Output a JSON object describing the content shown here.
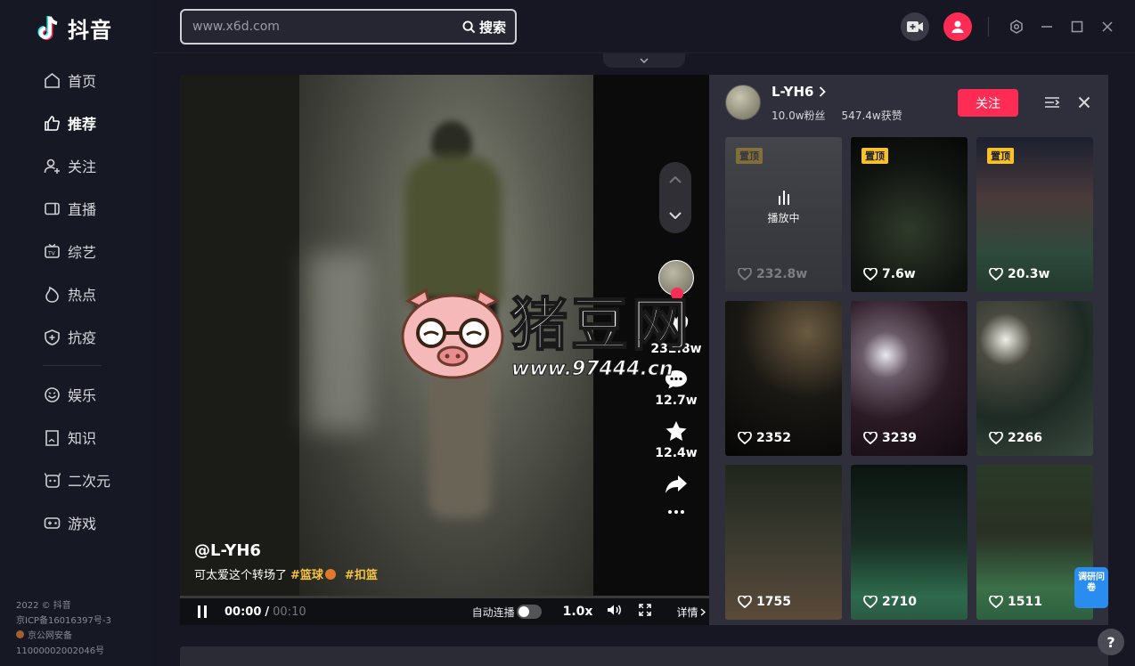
{
  "app": {
    "name": "抖音"
  },
  "search": {
    "placeholder": "www.x6d.com",
    "button_label": "搜索"
  },
  "sidebar": {
    "items": [
      {
        "label": "首页",
        "icon": "home-icon"
      },
      {
        "label": "推荐",
        "icon": "thumbs-up-icon",
        "active": true
      },
      {
        "label": "关注",
        "icon": "user-plus-icon"
      },
      {
        "label": "直播",
        "icon": "live-icon"
      },
      {
        "label": "综艺",
        "icon": "tv-icon"
      },
      {
        "label": "热点",
        "icon": "flame-icon"
      },
      {
        "label": "抗疫",
        "icon": "shield-plus-icon"
      }
    ],
    "items2": [
      {
        "label": "娱乐",
        "icon": "smile-icon"
      },
      {
        "label": "知识",
        "icon": "book-icon"
      },
      {
        "label": "二次元",
        "icon": "anime-icon"
      },
      {
        "label": "游戏",
        "icon": "gamepad-icon"
      }
    ],
    "footer": {
      "copyright": "2022 © 抖音",
      "icp": "京ICP备16016397号-3",
      "security": "京公网安备",
      "security_no": "11000002002046号"
    }
  },
  "player": {
    "author_handle": "@L-YH6",
    "caption": "可太爱这个转场了",
    "tags": [
      "#篮球",
      "#扣篮"
    ],
    "likes": "232.8w",
    "comments": "12.7w",
    "favorites": "12.4w",
    "time_current": "00:00",
    "time_separator": "/",
    "time_total": "00:10",
    "autoplay_label": "自动连播",
    "speed": "1.0x",
    "details_label": "详情",
    "progress": 0.0
  },
  "profile_panel": {
    "name": "L-YH6",
    "followers": "10.0w粉丝",
    "total_likes": "547.4w获赞",
    "follow_label": "关注",
    "playing_label": "播放中",
    "videos": [
      {
        "likes": "232.8w",
        "pinned": true,
        "pin_label": "置顶",
        "playing": true,
        "scene": "a"
      },
      {
        "likes": "7.6w",
        "pinned": true,
        "pin_label": "置顶",
        "playing": false,
        "scene": "b"
      },
      {
        "likes": "20.3w",
        "pinned": true,
        "pin_label": "置顶",
        "playing": false,
        "scene": "c"
      },
      {
        "likes": "2352",
        "pinned": false,
        "playing": false,
        "scene": "d"
      },
      {
        "likes": "3239",
        "pinned": false,
        "playing": false,
        "scene": "e"
      },
      {
        "likes": "2266",
        "pinned": false,
        "playing": false,
        "scene": "f"
      },
      {
        "likes": "1755",
        "pinned": false,
        "playing": false,
        "scene": "g"
      },
      {
        "likes": "2710",
        "pinned": false,
        "playing": false,
        "scene": "h"
      },
      {
        "likes": "1511",
        "pinned": false,
        "playing": false,
        "scene": "i"
      }
    ]
  },
  "watermark": {
    "text": "猪豆网",
    "url": "www.97444.cn"
  },
  "survey": {
    "label": "调研问卷"
  },
  "help": {
    "label": "?"
  }
}
